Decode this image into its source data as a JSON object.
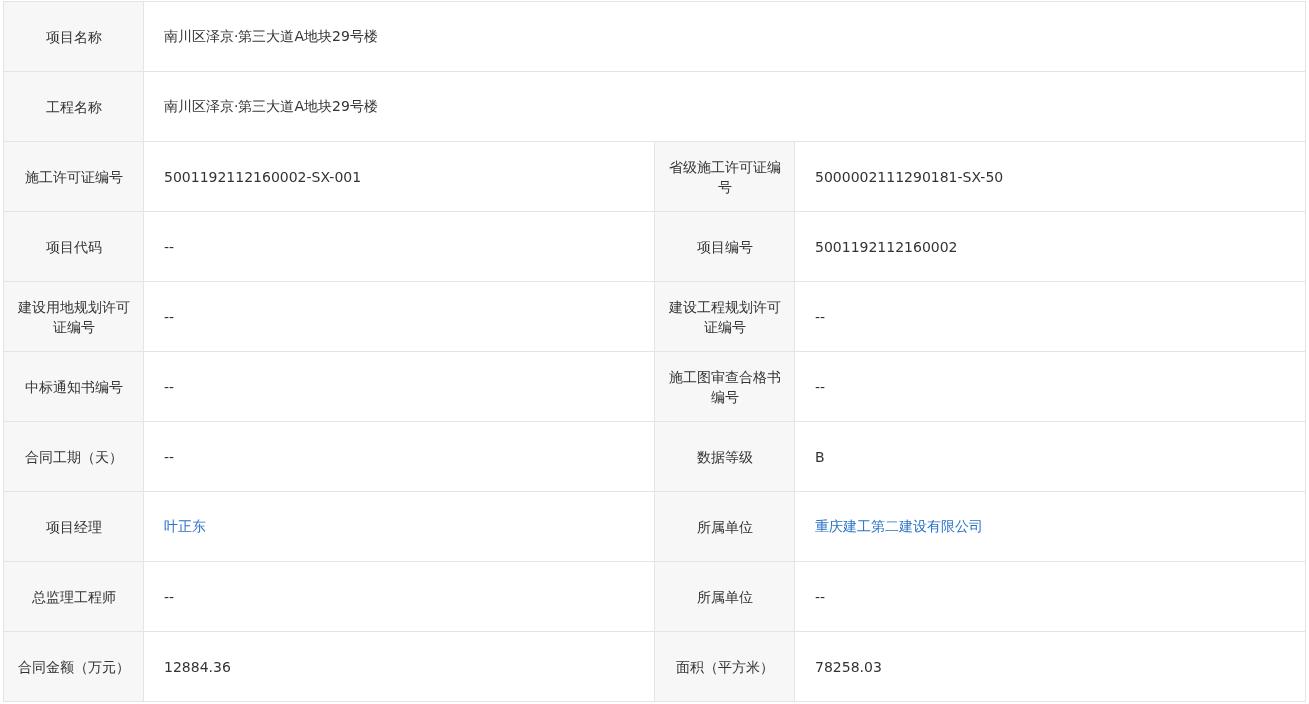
{
  "rows": [
    {
      "cells": [
        {
          "label": "项目名称",
          "value": "南川区泽京·第三大道A地块29号楼",
          "kind": "text"
        }
      ]
    },
    {
      "cells": [
        {
          "label": "工程名称",
          "value": "南川区泽京·第三大道A地块29号楼",
          "kind": "text"
        }
      ]
    },
    {
      "cells": [
        {
          "label": "施工许可证编号",
          "value": "5001192112160002-SX-001",
          "kind": "text"
        },
        {
          "label": "省级施工许可证编号",
          "value": "5000002111290181-SX-50",
          "kind": "text"
        }
      ]
    },
    {
      "cells": [
        {
          "label": "项目代码",
          "value": "--",
          "kind": "text"
        },
        {
          "label": "项目编号",
          "value": "5001192112160002",
          "kind": "text"
        }
      ]
    },
    {
      "cells": [
        {
          "label": "建设用地规划许可证编号",
          "value": "--",
          "kind": "text"
        },
        {
          "label": "建设工程规划许可证编号",
          "value": "--",
          "kind": "text"
        }
      ]
    },
    {
      "cells": [
        {
          "label": "中标通知书编号",
          "value": "--",
          "kind": "text"
        },
        {
          "label": "施工图审查合格书编号",
          "value": "--",
          "kind": "text"
        }
      ]
    },
    {
      "cells": [
        {
          "label": "合同工期（天）",
          "value": "--",
          "kind": "text"
        },
        {
          "label": "数据等级",
          "value": "B",
          "kind": "text"
        }
      ]
    },
    {
      "cells": [
        {
          "label": "项目经理",
          "value": "叶正东",
          "kind": "link"
        },
        {
          "label": "所属单位",
          "value": "重庆建工第二建设有限公司",
          "kind": "link"
        }
      ]
    },
    {
      "cells": [
        {
          "label": "总监理工程师",
          "value": "--",
          "kind": "text"
        },
        {
          "label": "所属单位",
          "value": "--",
          "kind": "text"
        }
      ]
    },
    {
      "cells": [
        {
          "label": "合同金额（万元）",
          "value": "12884.36",
          "kind": "text"
        },
        {
          "label": "面积（平方米）",
          "value": "78258.03",
          "kind": "text"
        }
      ]
    }
  ]
}
